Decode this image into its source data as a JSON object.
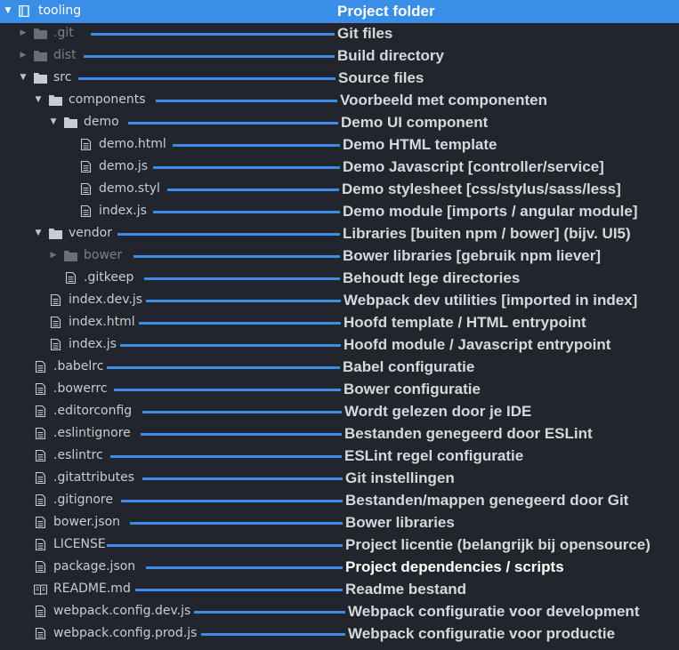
{
  "rows": [
    {
      "name": "tooling",
      "label": "Project folder",
      "icon": "repo-icon",
      "selected": true
    },
    {
      "name": ".git",
      "label": "Git files",
      "icon": "folder-icon",
      "dim": true
    },
    {
      "name": "dist",
      "label": "Build directory",
      "icon": "folder-icon",
      "dim": true
    },
    {
      "name": "src",
      "label": "Source files",
      "icon": "folder-icon"
    },
    {
      "name": "components",
      "label": "Voorbeeld met componenten",
      "icon": "folder-icon"
    },
    {
      "name": "demo",
      "label": "Demo UI component",
      "icon": "folder-icon"
    },
    {
      "name": "demo.html",
      "label": "Demo HTML template",
      "icon": "file-icon"
    },
    {
      "name": "demo.js",
      "label": "Demo Javascript [controller/service]",
      "icon": "file-icon"
    },
    {
      "name": "demo.styl",
      "label": "Demo stylesheet [css/stylus/sass/less]",
      "icon": "file-icon"
    },
    {
      "name": "index.js",
      "label": "Demo module [imports / angular module]",
      "icon": "file-icon"
    },
    {
      "name": "vendor",
      "label": "Libraries [buiten npm / bower] (bijv. UI5)",
      "icon": "folder-icon"
    },
    {
      "name": "bower",
      "label": "Bower libraries [gebruik npm liever]",
      "icon": "folder-icon",
      "dim": true
    },
    {
      "name": ".gitkeep",
      "label": "Behoudt lege directories",
      "icon": "file-icon"
    },
    {
      "name": "index.dev.js",
      "label": "Webpack dev utilities [imported in index]",
      "icon": "file-icon"
    },
    {
      "name": "index.html",
      "label": "Hoofd template / HTML entrypoint",
      "icon": "file-icon"
    },
    {
      "name": "index.js",
      "label": "Hoofd module / Javascript entrypoint",
      "icon": "file-icon"
    },
    {
      "name": ".babelrc",
      "label": "Babel configuratie",
      "icon": "file-icon"
    },
    {
      "name": ".bowerrc",
      "label": "Bower configuratie",
      "icon": "file-icon"
    },
    {
      "name": ".editorconfig",
      "label": "Wordt gelezen door je IDE",
      "icon": "file-icon"
    },
    {
      "name": ".eslintignore",
      "label": "Bestanden genegeerd door ESLint",
      "icon": "file-icon"
    },
    {
      "name": ".eslintrc",
      "label": "ESLint regel configuratie",
      "icon": "file-icon"
    },
    {
      "name": ".gitattributes",
      "label": "Git instellingen",
      "icon": "file-icon"
    },
    {
      "name": ".gitignore",
      "label": "Bestanden/mappen genegeerd door Git",
      "icon": "file-icon"
    },
    {
      "name": "bower.json",
      "label": "Bower libraries",
      "icon": "file-icon"
    },
    {
      "name": "LICENSE",
      "label": "Project licentie (belangrijk bij opensource)",
      "icon": "file-icon"
    },
    {
      "name": "package.json",
      "label": "Project dependencies / scripts",
      "icon": "file-icon",
      "label_white": true
    },
    {
      "name": "README.md",
      "label": "Readme bestand",
      "icon": "book-icon"
    },
    {
      "name": "webpack.config.dev.js",
      "label": "Webpack configuratie voor development",
      "icon": "file-icon"
    },
    {
      "name": "webpack.config.prod.js",
      "label": "Webpack configuratie voor productie",
      "icon": "file-icon"
    }
  ],
  "colors": {
    "accent": "#3a8ee6",
    "background": "#22262c"
  }
}
